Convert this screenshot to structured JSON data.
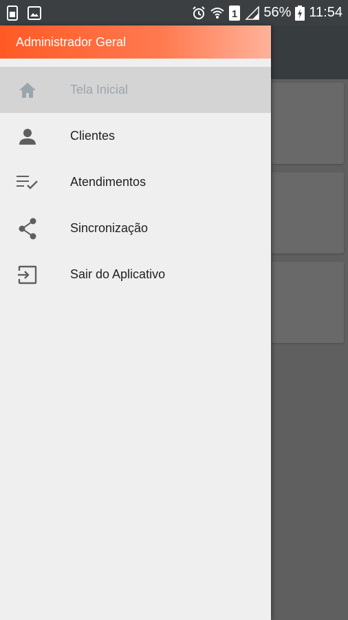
{
  "status_bar": {
    "battery_percent": "56%",
    "time": "11:54",
    "sim_slot": "1",
    "icons": [
      "sim-card-icon",
      "image-icon",
      "alarm-icon",
      "wifi-icon",
      "sim-1-icon",
      "signal-icon",
      "battery-charging-icon"
    ]
  },
  "drawer": {
    "header_title": "Administrador Geral",
    "items": [
      {
        "label": "Tela Inicial",
        "icon": "home-icon",
        "active": true
      },
      {
        "label": "Clientes",
        "icon": "person-icon",
        "active": false
      },
      {
        "label": "Atendimentos",
        "icon": "playlist-check-icon",
        "active": false
      },
      {
        "label": "Sincronização",
        "icon": "share-icon",
        "active": false
      },
      {
        "label": "Sair do Aplicativo",
        "icon": "exit-icon",
        "active": false
      }
    ]
  },
  "colors": {
    "header_gradient_start": "#ff5a25",
    "header_gradient_end": "#ffb29a",
    "active_item_bg": "#d4d4d4",
    "active_item_text": "#9aa6ad",
    "icon_color": "#5f5f5f"
  }
}
